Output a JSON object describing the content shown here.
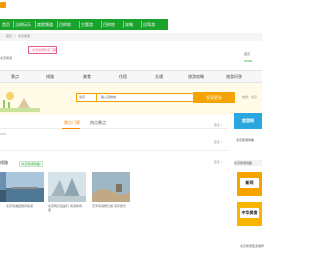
{
  "nav": {
    "items": [
      "首页",
      "当地玩乐",
      "度假频道",
      "目的地",
      "主题游",
      "目的地",
      "攻略",
      "自驾游"
    ],
    "bg_color": "#1aa32c"
  },
  "breadcrumb": [
    "首页",
    "北京旅游"
  ],
  "tag": "北京旅游景点门票",
  "header": {
    "sub_line": "北京旅游",
    "right_icon_label": "首页",
    "right_number": "51069"
  },
  "categories": [
    "景点",
    "线路",
    "美食",
    "住宿",
    "交通",
    "旅游攻略",
    "旅游问答"
  ],
  "search": {
    "city": "北京",
    "placeholder": "输入目的地",
    "button": "发现更多",
    "right_hint": "热搜：北京"
  },
  "ad": {
    "label": "旅游网"
  },
  "tabs": {
    "hot": "景点门票",
    "recommend": "热点景点",
    "more": "更多 >"
  },
  "right_side": {
    "label": "北京旅游攻略"
  },
  "route": {
    "title": "线路",
    "link": "[北京旅游线路]",
    "more": "更多 >",
    "photos": [
      {
        "caption": "北京海滩度假风情游"
      },
      {
        "caption": "北京两日自由行 海滨休闲游"
      },
      {
        "caption": "天津滨海两日游 海景观光"
      },
      {
        "caption": "北京到天津海港 一日游"
      }
    ]
  },
  "right_panel": {
    "title": "北京旅游线路",
    "cards": [
      "新闻",
      "中华美食"
    ],
    "list_item": "北京旅游更多推荐"
  }
}
